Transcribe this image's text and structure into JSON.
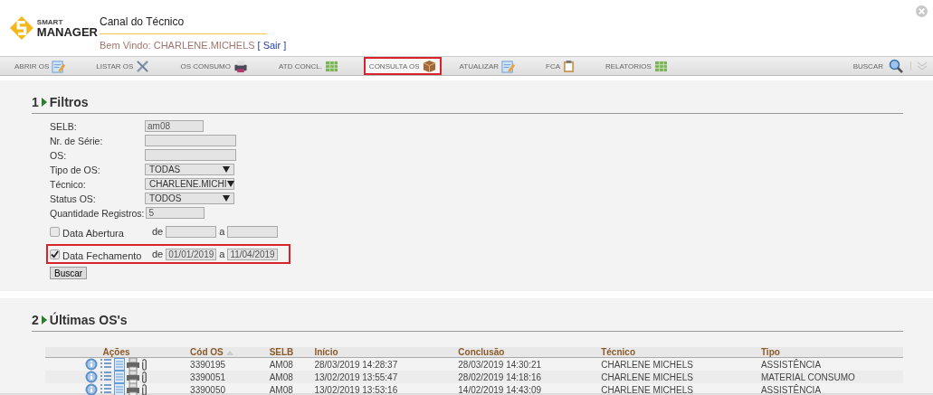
{
  "header": {
    "logo": "MANAGER",
    "logo_small": "SMART",
    "title": "Canal do Técnico",
    "welcome": "Bem Vindo: CHARLENE.MICHELS",
    "logout_open": "[",
    "logout": "Sair",
    "logout_close": "]"
  },
  "nav": {
    "tabs": [
      {
        "label": "ABRIR OS",
        "selected": false,
        "highlighted": false
      },
      {
        "label": "LISTAR OS",
        "selected": false,
        "highlighted": false
      },
      {
        "label": "OS CONSUMO",
        "selected": false,
        "highlighted": false
      },
      {
        "label": "ATD CONCL.",
        "selected": false,
        "highlighted": false
      },
      {
        "label": "CONSULTA OS",
        "selected": true,
        "highlighted": true
      },
      {
        "label": "ATUALIZAR",
        "selected": false,
        "highlighted": false
      },
      {
        "label": "FCA",
        "selected": false,
        "highlighted": false
      },
      {
        "label": "RELATORIOS",
        "selected": false,
        "highlighted": false
      }
    ],
    "search_label": "BUSCAR"
  },
  "filters": {
    "number": "1",
    "title": "Filtros",
    "fields": [
      {
        "kind": "shortfield",
        "label": "SELB:",
        "value": "am08"
      },
      {
        "kind": "longfield",
        "label": "Nr. de Série:"
      },
      {
        "kind": "longfield",
        "label": "OS:"
      },
      {
        "kind": "select",
        "label": "Tipo de OS:",
        "value": "TODAS"
      },
      {
        "kind": "select",
        "label": "Técnico:",
        "value": "CHARLENE.MICHI"
      },
      {
        "kind": "select",
        "label": "Status OS:",
        "value": "TODOS"
      },
      {
        "kind": "shortfield",
        "label": "Quantidade Registros:",
        "value": "5"
      }
    ],
    "date_ranges": [
      {
        "label": "Data Abertura",
        "checked": false,
        "highlighted": false,
        "from_label": "de",
        "to_label": "a"
      },
      {
        "label": "Data Fechamento",
        "checked": true,
        "highlighted": true,
        "from_label": "de",
        "from": "01/01/2019",
        "to_label": "a",
        "to": "11/04/2019"
      }
    ],
    "button": "Buscar"
  },
  "results": {
    "number": "2",
    "title": "Últimas OS's",
    "columns": [
      "Ações",
      "Cód OS",
      "SELB",
      "Início",
      "Conclusão",
      "Técnico",
      "Tipo"
    ],
    "rows": [
      [
        "",
        "3390195",
        "AM08",
        "28/03/2019 14:28:37",
        "28/03/2019 14:30:21",
        "CHARLENE MICHELS",
        "ASSISTÊNCIA"
      ],
      [
        "",
        "3390051",
        "AM08",
        "13/02/2019 13:55:47",
        "28/02/2019 14:18:16",
        "CHARLENE MICHELS",
        "MATERIAL CONSUMO"
      ],
      [
        "",
        "3390050",
        "AM08",
        "13/02/2019 13:53:16",
        "14/02/2019 14:43:09",
        "CHARLENE MICHELS",
        "ASSISTÊNCIA"
      ]
    ]
  }
}
